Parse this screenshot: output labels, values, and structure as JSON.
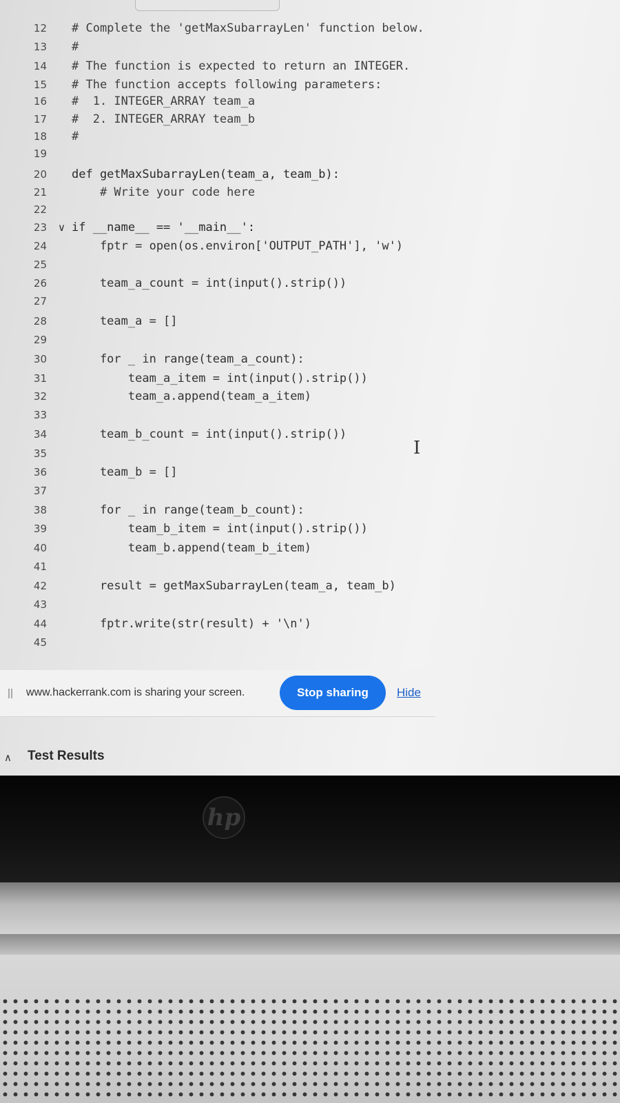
{
  "editor": {
    "lines": [
      {
        "num": "12",
        "code": "# Complete the 'getMaxSubarrayLen' function below."
      },
      {
        "num": "13",
        "code": "#"
      },
      {
        "num": "14",
        "code": "# The function is expected to return an INTEGER."
      },
      {
        "num": "15",
        "code": "# The function accepts following parameters:"
      },
      {
        "num": "16",
        "code": "#  1. INTEGER_ARRAY team_a"
      },
      {
        "num": "17",
        "code": "#  2. INTEGER_ARRAY team_b"
      },
      {
        "num": "18",
        "code": "#"
      },
      {
        "num": "19",
        "code": ""
      },
      {
        "num": "20",
        "code": "def getMaxSubarrayLen(team_a, team_b):"
      },
      {
        "num": "21",
        "code": "    # Write your code here"
      },
      {
        "num": "22",
        "code": ""
      },
      {
        "num": "23",
        "code": "if __name__ == '__main__':"
      },
      {
        "num": "24",
        "code": "    fptr = open(os.environ['OUTPUT_PATH'], 'w')"
      },
      {
        "num": "25",
        "code": ""
      },
      {
        "num": "26",
        "code": "    team_a_count = int(input().strip())"
      },
      {
        "num": "27",
        "code": ""
      },
      {
        "num": "28",
        "code": "    team_a = []"
      },
      {
        "num": "29",
        "code": ""
      },
      {
        "num": "30",
        "code": "    for _ in range(team_a_count):"
      },
      {
        "num": "31",
        "code": "        team_a_item = int(input().strip())"
      },
      {
        "num": "32",
        "code": "        team_a.append(team_a_item)"
      },
      {
        "num": "33",
        "code": ""
      },
      {
        "num": "34",
        "code": "    team_b_count = int(input().strip())"
      },
      {
        "num": "35",
        "code": ""
      },
      {
        "num": "36",
        "code": "    team_b = []"
      },
      {
        "num": "37",
        "code": ""
      },
      {
        "num": "38",
        "code": "    for _ in range(team_b_count):"
      },
      {
        "num": "39",
        "code": "        team_b_item = int(input().strip())"
      },
      {
        "num": "40",
        "code": "        team_b.append(team_b_item)"
      },
      {
        "num": "41",
        "code": ""
      },
      {
        "num": "42",
        "code": "    result = getMaxSubarrayLen(team_a, team_b)"
      },
      {
        "num": "43",
        "code": ""
      },
      {
        "num": "44",
        "code": "    fptr.write(str(result) + '\\n')"
      },
      {
        "num": "45",
        "code": ""
      }
    ],
    "fold_icon": "chevron-down-icon",
    "text_cursor_icon": "i-beam-cursor-icon"
  },
  "sharing_bar": {
    "message": "www.hackerrank.com is sharing your screen.",
    "stop_label": "Stop sharing",
    "hide_label": "Hide",
    "stop_color": "#1a73e8"
  },
  "panel": {
    "test_results_label": "Test Results",
    "toggle_icon": "caret-up-icon"
  },
  "device": {
    "logo_text": "hp"
  }
}
